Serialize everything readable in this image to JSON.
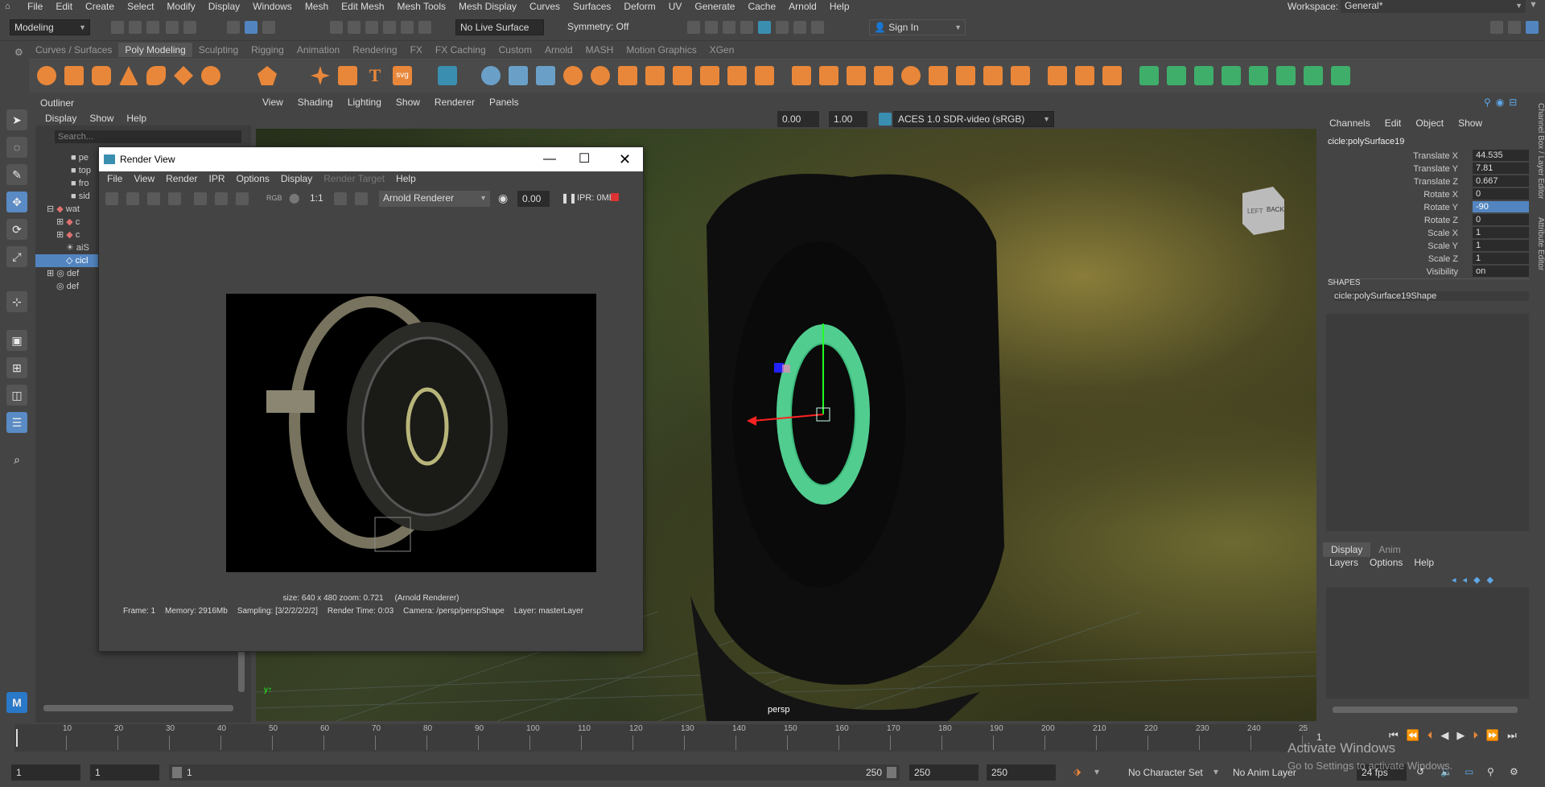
{
  "menubar": {
    "items": [
      "File",
      "Edit",
      "Create",
      "Select",
      "Modify",
      "Display",
      "Windows",
      "Mesh",
      "Edit Mesh",
      "Mesh Tools",
      "Mesh Display",
      "Curves",
      "Surfaces",
      "Deform",
      "UV",
      "Generate",
      "Cache",
      "Arnold",
      "Help"
    ],
    "workspace_label": "Workspace:",
    "workspace_value": "General*"
  },
  "statusline": {
    "mode": "Modeling",
    "live_surface": "No Live Surface",
    "symmetry": "Symmetry: Off",
    "sign_in": "Sign In"
  },
  "shelf": {
    "tabs": [
      "Curves / Surfaces",
      "Poly Modeling",
      "Sculpting",
      "Rigging",
      "Animation",
      "Rendering",
      "FX",
      "FX Caching",
      "Custom",
      "Arnold",
      "MASH",
      "Motion Graphics",
      "XGen"
    ],
    "active_tab": "Poly Modeling",
    "svg_label": "svg"
  },
  "outliner": {
    "title": "Outliner",
    "menus": [
      "Display",
      "Show",
      "Help"
    ],
    "search_placeholder": "Search...",
    "rows": [
      "pe",
      "top",
      "fro",
      "sid",
      "wat",
      "c",
      "c",
      "aiS",
      "cicl",
      "def",
      "def"
    ]
  },
  "viewport": {
    "menus": [
      "View",
      "Shading",
      "Lighting",
      "Show",
      "Renderer",
      "Panels"
    ],
    "field1": "0.00",
    "field2": "1.00",
    "color_space": "ACES 1.0 SDR-video (sRGB)",
    "camera_label": "persp",
    "viewcube_left": "LEFT",
    "viewcube_back": "BACK"
  },
  "render_view": {
    "title": "Render View",
    "menus": [
      "File",
      "View",
      "Render",
      "IPR",
      "Options",
      "Display",
      "Render Target",
      "Help"
    ],
    "ratio": "1:1",
    "renderer": "Arnold Renderer",
    "exposure": "0.00",
    "ipr_status": "IPR: 0MB",
    "rgb_label": "RGB",
    "size_info": "size: 640 x 480 zoom: 0.721     (Arnold Renderer)",
    "frame": "Frame: 1",
    "memory": "Memory: 2916Mb",
    "sampling": "Sampling: [3/2/2/2/2/2]",
    "render_time": "Render Time: 0:03",
    "camera": "Camera: /persp/perspShape",
    "layer": "Layer: masterLayer"
  },
  "channel_box": {
    "menus": [
      "Channels",
      "Edit",
      "Object",
      "Show"
    ],
    "object_name": "cicle:polySurface19",
    "attributes": [
      {
        "label": "Translate X",
        "value": "44.535"
      },
      {
        "label": "Translate Y",
        "value": "7.81"
      },
      {
        "label": "Translate Z",
        "value": "0.667"
      },
      {
        "label": "Rotate X",
        "value": "0"
      },
      {
        "label": "Rotate Y",
        "value": "-90"
      },
      {
        "label": "Rotate Z",
        "value": "0"
      },
      {
        "label": "Scale X",
        "value": "1"
      },
      {
        "label": "Scale Y",
        "value": "1"
      },
      {
        "label": "Scale Z",
        "value": "1"
      },
      {
        "label": "Visibility",
        "value": "on"
      }
    ],
    "shapes_header": "SHAPES",
    "shape_name": "cicle:polySurface19Shape",
    "side_tab1": "Channel Box / Layer Editor",
    "side_tab2": "Attribute Editor"
  },
  "layer_editor": {
    "tabs": [
      "Display",
      "Anim"
    ],
    "menus": [
      "Layers",
      "Options",
      "Help"
    ]
  },
  "timeline": {
    "ticks": [
      "10",
      "20",
      "30",
      "40",
      "50",
      "60",
      "70",
      "80",
      "90",
      "100",
      "110",
      "120",
      "130",
      "140",
      "150",
      "160",
      "170",
      "180",
      "190",
      "200",
      "210",
      "220",
      "230",
      "240",
      "25"
    ],
    "current_frame": "1"
  },
  "range": {
    "start": "1",
    "start2": "1",
    "slider_start": "1",
    "slider_end": "250",
    "end": "250",
    "end2": "250",
    "character_set": "No Character Set",
    "anim_layer": "No Anim Layer",
    "fps": "24 fps"
  },
  "watermark": {
    "line1": "Activate Windows",
    "line2": "Go to Settings to activate Windows."
  },
  "colors": {
    "selection": "#5285c0",
    "manipulator": "#5ef0a8"
  }
}
